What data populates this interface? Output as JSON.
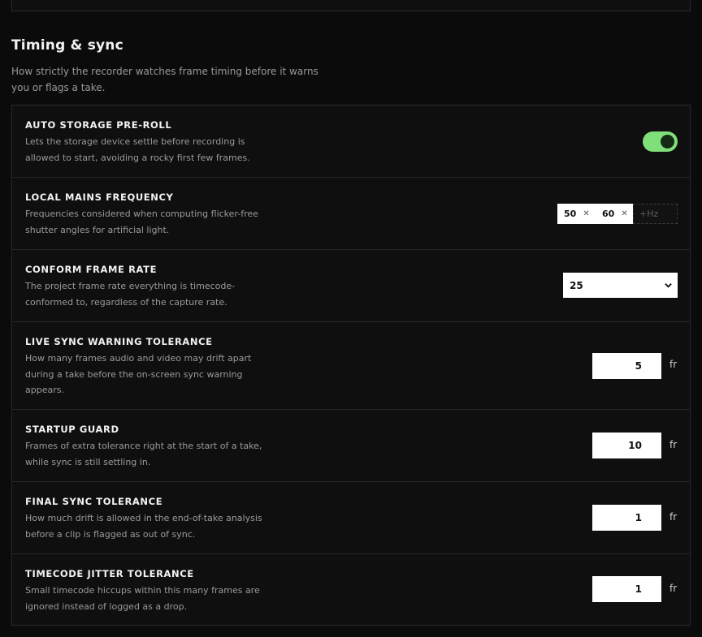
{
  "section": {
    "title": "Timing & sync",
    "description": "How strictly the recorder watches frame timing before it warns you or flags a take."
  },
  "settings": [
    {
      "title": "AUTO STORAGE PRE-ROLL",
      "description": "Lets the storage device settle before recording is allowed to start, avoiding a rocky first few frames.",
      "control": "toggle",
      "enabled": true
    },
    {
      "title": "LOCAL MAINS FREQUENCY",
      "description": "Frequencies considered when computing flicker-free shutter angles for artificial light.",
      "control": "chips",
      "chips": [
        "50",
        "60"
      ],
      "chip_remove_icon": "close-icon",
      "input_placeholder": "+Hz"
    },
    {
      "title": "CONFORM FRAME RATE",
      "description": "The project frame rate everything is timecode-conformed to, regardless of the capture rate.",
      "control": "select",
      "value": "25"
    },
    {
      "title": "LIVE SYNC WARNING TOLERANCE",
      "description": "How many frames audio and video may drift apart during a take before the on-screen sync warning appears.",
      "control": "number",
      "value": "5",
      "unit": "fr"
    },
    {
      "title": "STARTUP GUARD",
      "description": "Frames of extra tolerance right at the start of a take, while sync is still settling in.",
      "control": "number",
      "value": "10",
      "unit": "fr"
    },
    {
      "title": "FINAL SYNC TOLERANCE",
      "description": "How much drift is allowed in the end-of-take analysis before a clip is flagged as out of sync.",
      "control": "number",
      "value": "1",
      "unit": "fr"
    },
    {
      "title": "TIMECODE JITTER TOLERANCE",
      "description": "Small timecode hiccups within this many frames are ignored instead of logged as a drop.",
      "control": "number",
      "value": "1",
      "unit": "fr"
    }
  ],
  "colors": {
    "background": "#0b0b0b",
    "card": "#0f0f0f",
    "toggle_on": "#7fe07a",
    "text_primary": "#f2f2f2",
    "text_secondary": "#9a9a9a"
  }
}
